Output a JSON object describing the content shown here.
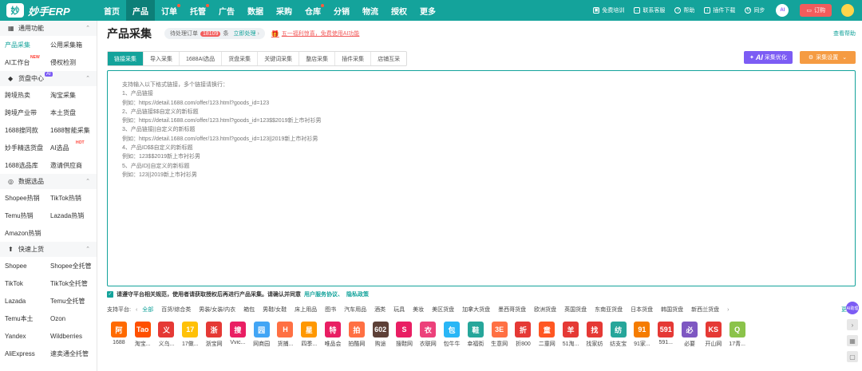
{
  "app": {
    "logo_mark": "妙",
    "logo_text": "妙手ERP"
  },
  "nav": [
    {
      "label": "首页",
      "active": false,
      "dot": false
    },
    {
      "label": "产品",
      "active": true,
      "dot": false
    },
    {
      "label": "订单",
      "active": false,
      "dot": true
    },
    {
      "label": "托管",
      "active": false,
      "dot": true
    },
    {
      "label": "广告",
      "active": false,
      "dot": false
    },
    {
      "label": "数据",
      "active": false,
      "dot": false
    },
    {
      "label": "采购",
      "active": false,
      "dot": false
    },
    {
      "label": "仓库",
      "active": false,
      "dot": true
    },
    {
      "label": "分销",
      "active": false,
      "dot": false
    },
    {
      "label": "物流",
      "active": false,
      "dot": false
    },
    {
      "label": "授权",
      "active": false,
      "dot": false
    },
    {
      "label": "更多",
      "active": false,
      "dot": false
    }
  ],
  "top_right": {
    "training": "免费培训",
    "support": "联系客服",
    "help": "帮助",
    "plugin": "插件下载",
    "sync": "同步",
    "ai": "AI",
    "order": "订购"
  },
  "sidebar": {
    "sections": [
      {
        "title": "通用功能",
        "icon": "grid-icon",
        "ai": false,
        "items": [
          {
            "label": "产品采集",
            "active": true,
            "new": ""
          },
          {
            "label": "公用采集箱",
            "active": false,
            "new": ""
          },
          {
            "label": "AI工作台",
            "active": false,
            "new": "NEW"
          },
          {
            "label": "侵权检测",
            "active": false,
            "new": ""
          }
        ]
      },
      {
        "title": "货盘中心",
        "icon": "box-icon",
        "ai": true,
        "items": [
          {
            "label": "跨境热卖",
            "active": false,
            "new": ""
          },
          {
            "label": "淘宝采集",
            "active": false,
            "new": ""
          },
          {
            "label": "跨境产业带",
            "active": false,
            "new": ""
          },
          {
            "label": "本土货盘",
            "active": false,
            "new": ""
          },
          {
            "label": "1688搜同款",
            "active": false,
            "new": ""
          },
          {
            "label": "1688智能采集",
            "active": false,
            "new": ""
          },
          {
            "label": "妙手精选货盘",
            "active": false,
            "new": ""
          },
          {
            "label": "AI选品",
            "active": false,
            "new": "HOT"
          },
          {
            "label": "1688选品库",
            "active": false,
            "new": ""
          },
          {
            "label": "邀请供应商",
            "active": false,
            "new": ""
          }
        ]
      },
      {
        "title": "数据选品",
        "icon": "chart-icon",
        "ai": false,
        "items": [
          {
            "label": "Shopee热销",
            "active": false,
            "new": ""
          },
          {
            "label": "TikTok热销",
            "active": false,
            "new": ""
          },
          {
            "label": "Temu热销",
            "active": false,
            "new": ""
          },
          {
            "label": "Lazada热销",
            "active": false,
            "new": ""
          },
          {
            "label": "Amazon热销",
            "active": false,
            "new": ""
          }
        ]
      },
      {
        "title": "快速上货",
        "icon": "upload-icon",
        "ai": false,
        "items": [
          {
            "label": "Shopee",
            "active": false,
            "new": ""
          },
          {
            "label": "Shopee全托管",
            "active": false,
            "new": ""
          },
          {
            "label": "TikTok",
            "active": false,
            "new": ""
          },
          {
            "label": "TikTok全托管",
            "active": false,
            "new": ""
          },
          {
            "label": "Lazada",
            "active": false,
            "new": ""
          },
          {
            "label": "Temu全托管",
            "active": false,
            "new": ""
          },
          {
            "label": "Temu本土",
            "active": false,
            "new": ""
          },
          {
            "label": "Ozon",
            "active": false,
            "new": ""
          },
          {
            "label": "Yandex",
            "active": false,
            "new": ""
          },
          {
            "label": "Wildberries",
            "active": false,
            "new": ""
          },
          {
            "label": "AliExpress",
            "active": false,
            "new": ""
          },
          {
            "label": "速卖通全托管",
            "active": false,
            "new": ""
          }
        ]
      }
    ]
  },
  "main": {
    "title": "产品采集",
    "pending_prefix": "待处理订单",
    "pending_count": "18109",
    "pending_unit": "条",
    "pending_action": "立即处理",
    "promo": "五一福利惊喜，免费使用AI功能",
    "help": "查看帮助",
    "tabs": [
      {
        "label": "链接采集",
        "active": true
      },
      {
        "label": "导入采集",
        "active": false
      },
      {
        "label": "1688AI选品",
        "active": false
      },
      {
        "label": "货盘采集",
        "active": false
      },
      {
        "label": "关键词采集",
        "active": false
      },
      {
        "label": "整店采集",
        "active": false
      },
      {
        "label": "插件采集",
        "active": false
      },
      {
        "label": "店铺互采",
        "active": false
      }
    ],
    "ai_optimize_ai": "AI",
    "ai_optimize": "采集优化",
    "collect_settings": "采集设置",
    "placeholder": "支持输入以下格式链接，多个链接请换行：\n1、产品链接\n例如：https://detail.1688.com/offer/123.html?goods_id=123\n2、产品链接$$自定义的新标题\n例如：https://detail.1688.com/offer/123.html?goods_id=123$$2019新上市衬衫男\n3、产品链接||自定义的新标题\n例如：https://detail.1688.com/offer/123.html?goods_id=123||2019新上市衬衫男\n4、产品ID$$自定义的新标题\n例如：123$$2019新上市衬衫男\n5、产品ID||自定义的新标题\n例如：123||2019新上市衬衫男",
    "agree_text": "请遵守平台相关规范，使用者请获取授权后再进行产品采集。请确认并同意",
    "agree_link1": "用户服务协议、",
    "agree_link2": "隐私政策",
    "platform_label": "支持平台:",
    "categories": [
      {
        "label": "全部",
        "active": true
      },
      {
        "label": "百货/综合类",
        "active": false
      },
      {
        "label": "男装/女装/内衣",
        "active": false
      },
      {
        "label": "箱包",
        "active": false
      },
      {
        "label": "男鞋/女鞋",
        "active": false
      },
      {
        "label": "床上用品",
        "active": false
      },
      {
        "label": "图书",
        "active": false
      },
      {
        "label": "汽车用品",
        "active": false
      },
      {
        "label": "酒类",
        "active": false
      },
      {
        "label": "玩具",
        "active": false
      },
      {
        "label": "美妆",
        "active": false
      },
      {
        "label": "美区货盘",
        "active": false
      },
      {
        "label": "加拿大货盘",
        "active": false
      },
      {
        "label": "墨西哥货盘",
        "active": false
      },
      {
        "label": "欧洲货盘",
        "active": false
      },
      {
        "label": "英国货盘",
        "active": false
      },
      {
        "label": "东南亚货盘",
        "active": false
      },
      {
        "label": "日本货盘",
        "active": false
      },
      {
        "label": "韩国货盘",
        "active": false
      },
      {
        "label": "新西兰货盘",
        "active": false
      }
    ],
    "more": "更多",
    "platforms": [
      {
        "name": "1688",
        "mark": "阿",
        "color": "#ff6a00"
      },
      {
        "name": "淘宝...",
        "mark": "Tao",
        "color": "#ff5000"
      },
      {
        "name": "义乌...",
        "mark": "义",
        "color": "#e53935"
      },
      {
        "name": "17做...",
        "mark": "17",
        "color": "#ffc107"
      },
      {
        "name": "浙宝网",
        "mark": "浙",
        "color": "#e53935"
      },
      {
        "name": "Vvic...",
        "mark": "搜",
        "color": "#e91e63"
      },
      {
        "name": "网商园",
        "mark": "园",
        "color": "#42a5f5"
      },
      {
        "name": "货捕...",
        "mark": "H",
        "color": "#ff7043"
      },
      {
        "name": "四季...",
        "mark": "星",
        "color": "#ff9800"
      },
      {
        "name": "唯品会",
        "mark": "特",
        "color": "#e91e63"
      },
      {
        "name": "拍酷网",
        "mark": "拍",
        "color": "#ff7043"
      },
      {
        "name": "购途",
        "mark": "602",
        "color": "#5d4037"
      },
      {
        "name": "搜鞋网",
        "mark": "S",
        "color": "#e91e63"
      },
      {
        "name": "衣联网",
        "mark": "衣",
        "color": "#ec407a"
      },
      {
        "name": "包牛牛",
        "mark": "包",
        "color": "#29b6f6"
      },
      {
        "name": "幸福街",
        "mark": "鞋",
        "color": "#26a69a"
      },
      {
        "name": "生意网",
        "mark": "3E",
        "color": "#ff7043"
      },
      {
        "name": "折800",
        "mark": "折",
        "color": "#e53935"
      },
      {
        "name": "二童网",
        "mark": "童",
        "color": "#ff5722"
      },
      {
        "name": "51淘...",
        "mark": "羊",
        "color": "#e53935"
      },
      {
        "name": "找家纺",
        "mark": "找",
        "color": "#e53935"
      },
      {
        "name": "纺支宝",
        "mark": "纺",
        "color": "#26a69a"
      },
      {
        "name": "91家...",
        "mark": "91",
        "color": "#f57c00"
      },
      {
        "name": "591...",
        "mark": "591",
        "color": "#e53935"
      },
      {
        "name": "必要",
        "mark": "必",
        "color": "#7e57c2"
      },
      {
        "name": "开山网",
        "mark": "KS",
        "color": "#e53935"
      },
      {
        "name": "17青...",
        "mark": "Q",
        "color": "#8bc34a"
      }
    ],
    "ai_assistant": "AI助理"
  }
}
